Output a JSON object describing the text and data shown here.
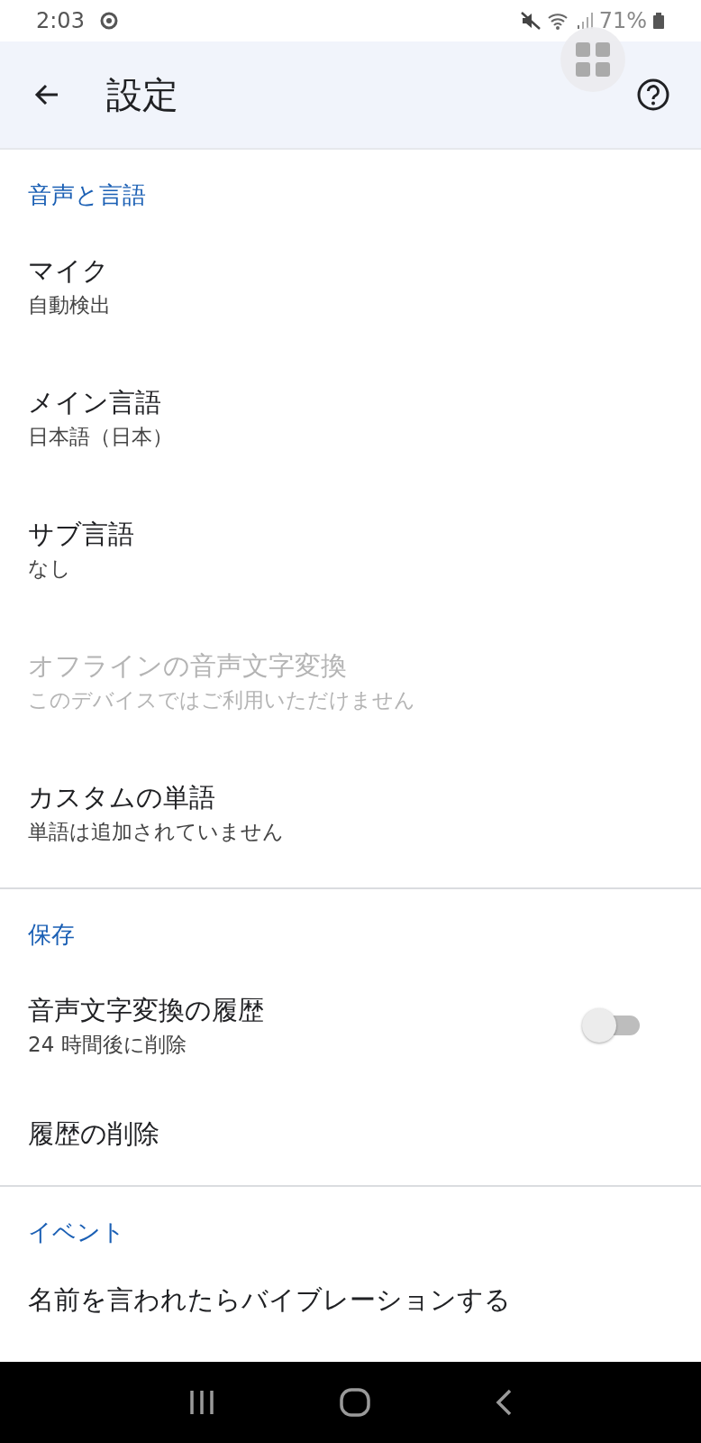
{
  "status_bar": {
    "time": "2:03",
    "battery": "71%"
  },
  "app_bar": {
    "title": "設定"
  },
  "sections": [
    {
      "header": "音声と言語",
      "items": [
        {
          "kind": "plain",
          "title": "マイク",
          "subtitle": "自動検出",
          "disabled": false
        },
        {
          "kind": "plain",
          "title": "メイン言語",
          "subtitle": "日本語（日本）",
          "disabled": false
        },
        {
          "kind": "plain",
          "title": "サブ言語",
          "subtitle": "なし",
          "disabled": false
        },
        {
          "kind": "plain",
          "title": "オフラインの音声文字変換",
          "subtitle": "このデバイスではご利用いただけません",
          "disabled": true
        },
        {
          "kind": "plain",
          "title": "カスタムの単語",
          "subtitle": "単語は追加されていません",
          "disabled": false
        }
      ]
    },
    {
      "header": "保存",
      "items": [
        {
          "kind": "toggle",
          "title": "音声文字変換の履歴",
          "subtitle": "24 時間後に削除",
          "disabled": false,
          "on": false
        },
        {
          "kind": "plain",
          "title": "履歴の削除",
          "disabled": false
        }
      ]
    },
    {
      "header": "イベント",
      "items": [
        {
          "kind": "plain",
          "title": "名前を言われたらバイブレーションする",
          "disabled": false
        }
      ]
    }
  ]
}
